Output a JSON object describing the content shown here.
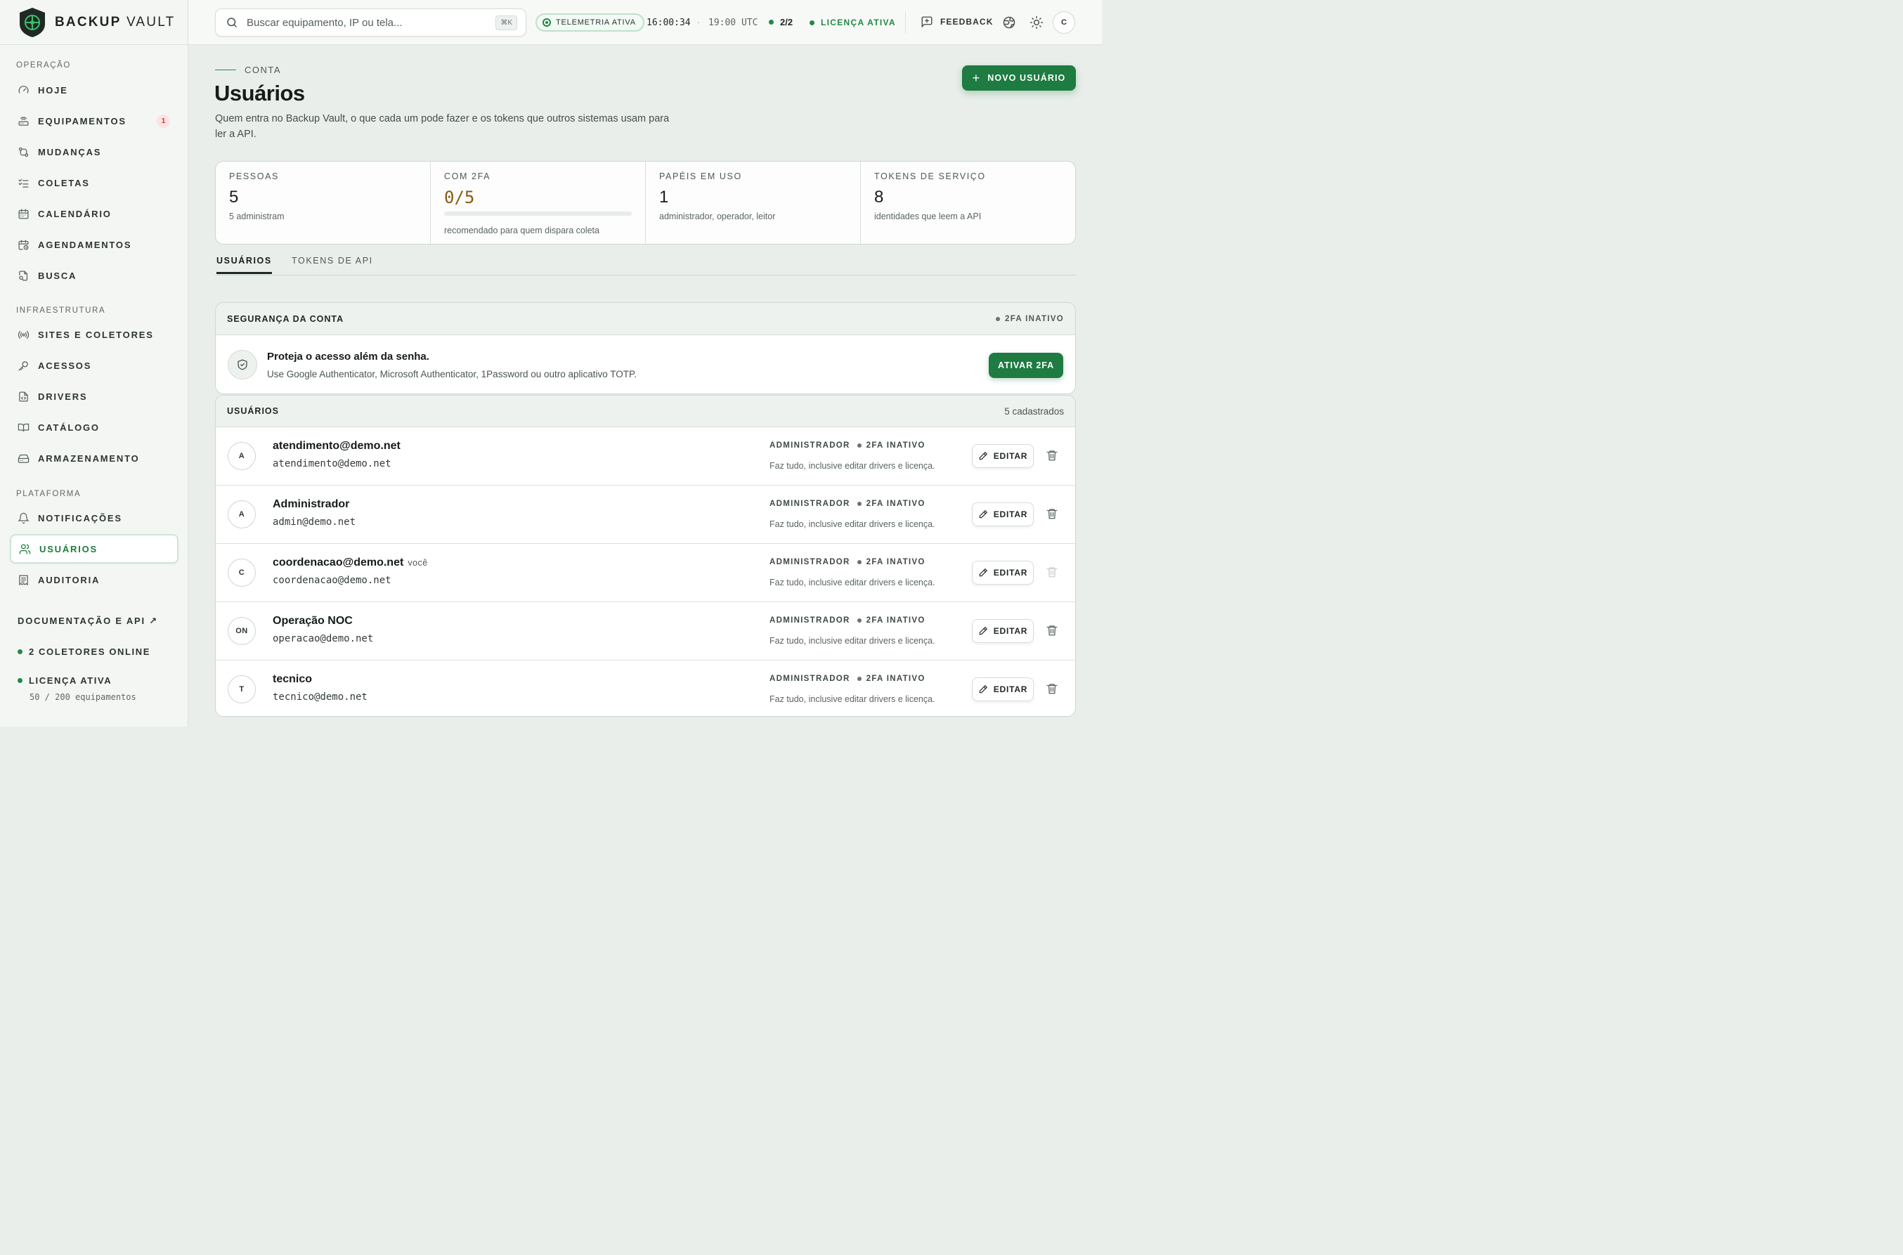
{
  "brand": {
    "name_bold": "BACKUP",
    "name_light": "VAULT"
  },
  "sidebar": {
    "sections": [
      {
        "label": "OPERAÇÃO"
      },
      {
        "label": "INFRAESTRUTURA"
      },
      {
        "label": "PLATAFORMA"
      }
    ],
    "items": [
      {
        "label": "HOJE",
        "icon": "gauge-icon"
      },
      {
        "label": "EQUIPAMENTOS",
        "icon": "router-icon",
        "badge": "1"
      },
      {
        "label": "MUDANÇAS",
        "icon": "git-compare-icon"
      },
      {
        "label": "COLETAS",
        "icon": "list-check-icon"
      },
      {
        "label": "CALENDÁRIO",
        "icon": "calendar-icon"
      },
      {
        "label": "AGENDAMENTOS",
        "icon": "calendar-clock-icon"
      },
      {
        "label": "BUSCA",
        "icon": "file-search-icon"
      },
      {
        "label": "SITES E COLETORES",
        "icon": "radio-icon"
      },
      {
        "label": "ACESSOS",
        "icon": "key-icon"
      },
      {
        "label": "DRIVERS",
        "icon": "file-code-icon"
      },
      {
        "label": "CATÁLOGO",
        "icon": "book-icon"
      },
      {
        "label": "ARMAZENAMENTO",
        "icon": "storage-icon"
      },
      {
        "label": "NOTIFICAÇÕES",
        "icon": "bell-icon"
      },
      {
        "label": "USUÁRIOS",
        "icon": "users-icon",
        "active": true
      },
      {
        "label": "AUDITORIA",
        "icon": "receipt-icon"
      }
    ],
    "docs_label": "DOCUMENTAÇÃO E API ↗",
    "collectors_online": "2 COLETORES ONLINE",
    "license": "LICENÇA ATIVA",
    "license_usage": "50 / 200 equipamentos"
  },
  "topbar": {
    "search_placeholder": "Buscar equipamento, IP ou tela...",
    "search_shortcut": "⌘K",
    "telemetry": "TELEMETRIA ATIVA",
    "local_time": "16:00:34",
    "separator": "·",
    "utc_time": "19:00 UTC",
    "collectors_ratio": "2/2",
    "license": "LICENÇA ATIVA",
    "feedback": "FEEDBACK",
    "user_initial": "C"
  },
  "page": {
    "eyebrow": "CONTA",
    "title": "Usuários",
    "description": "Quem entra no Backup Vault, o que cada um pode fazer e os tokens que outros sistemas usam para ler a API.",
    "new_user_button": "NOVO USUÁRIO"
  },
  "stats": [
    {
      "label": "PESSOAS",
      "value": "5",
      "sub": "5 administram"
    },
    {
      "label": "COM 2FA",
      "value": "0/5",
      "sub": "recomendado para quem dispara coleta",
      "progress": 0
    },
    {
      "label": "PAPÉIS EM USO",
      "value": "1",
      "sub": "administrador, operador, leitor"
    },
    {
      "label": "TOKENS DE SERVIÇO",
      "value": "8",
      "sub": "identidades que leem a API"
    }
  ],
  "tabs": [
    {
      "label": "USUÁRIOS",
      "active": true
    },
    {
      "label": "TOKENS DE API",
      "active": false
    }
  ],
  "security": {
    "title": "SEGURANÇA DA CONTA",
    "status": "2FA INATIVO",
    "headline": "Proteja o acesso além da senha.",
    "description": "Use Google Authenticator, Microsoft Authenticator, 1Password ou outro aplicativo TOTP.",
    "button": "ATIVAR 2FA"
  },
  "users": {
    "title": "USUÁRIOS",
    "count": "5 cadastrados",
    "edit_label": "EDITAR",
    "rows": [
      {
        "initials": "A",
        "name": "atendimento@demo.net",
        "you": "",
        "email": "atendimento@demo.net",
        "role": "ADMINISTRADOR",
        "twofa": "2FA INATIVO",
        "desc": "Faz tudo, inclusive editar drivers e licença.",
        "can_delete": true
      },
      {
        "initials": "A",
        "name": "Administrador",
        "you": "",
        "email": "admin@demo.net",
        "role": "ADMINISTRADOR",
        "twofa": "2FA INATIVO",
        "desc": "Faz tudo, inclusive editar drivers e licença.",
        "can_delete": true
      },
      {
        "initials": "C",
        "name": "coordenacao@demo.net",
        "you": "você",
        "email": "coordenacao@demo.net",
        "role": "ADMINISTRADOR",
        "twofa": "2FA INATIVO",
        "desc": "Faz tudo, inclusive editar drivers e licença.",
        "can_delete": false
      },
      {
        "initials": "ON",
        "name": "Operação NOC",
        "you": "",
        "email": "operacao@demo.net",
        "role": "ADMINISTRADOR",
        "twofa": "2FA INATIVO",
        "desc": "Faz tudo, inclusive editar drivers e licença.",
        "can_delete": true
      },
      {
        "initials": "T",
        "name": "tecnico",
        "you": "",
        "email": "tecnico@demo.net",
        "role": "ADMINISTRADOR",
        "twofa": "2FA INATIVO",
        "desc": "Faz tudo, inclusive editar drivers e licença.",
        "can_delete": true
      }
    ]
  },
  "colors": {
    "accent": "#1e7b41",
    "warning": "#8a5a12",
    "danger": "#c43a3a"
  }
}
